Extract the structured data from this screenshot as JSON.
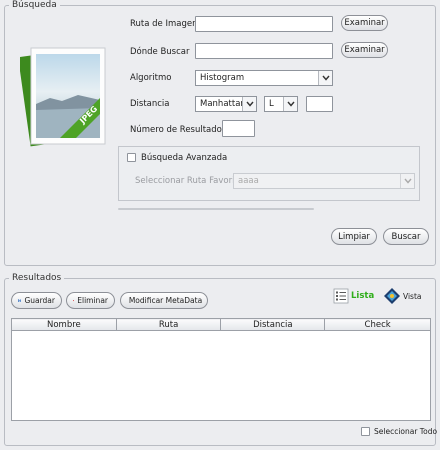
{
  "search": {
    "legend": "Búsqueda",
    "image_path": {
      "label": "Ruta de Imagen",
      "value": ""
    },
    "search_where": {
      "label": "Dónde Buscar",
      "value": ""
    },
    "browse_label": "Examinar",
    "algorithm": {
      "label": "Algoritmo",
      "selected": "Histogram"
    },
    "distance": {
      "label": "Distancia",
      "metric": "Manhattan",
      "norm": "L",
      "value": ""
    },
    "result_count": {
      "label": "Número de Resultados",
      "value": ""
    },
    "thumbnail_badge": "JPEG",
    "advanced": {
      "label": "Búsqueda Avanzada",
      "checked": false,
      "favorite_route_label": "Seleccionar Ruta Favorita",
      "favorite_route_value": "aaaa"
    },
    "clear_label": "Limpiar",
    "search_label": "Buscar"
  },
  "results": {
    "legend": "Resultados",
    "save_label": "Guardar",
    "delete_label": "Eliminar",
    "modify_metadata_label": "Modificar MetaData",
    "list_view_label": "Lista",
    "grid_view_label": "Vista",
    "columns": [
      "Nombre",
      "Ruta",
      "Distancia",
      "Check"
    ],
    "rows": [],
    "select_all_label": "Seleccionar Todo"
  },
  "colors": {
    "list_view_active": "#2fae1a",
    "delete_icon": "#d0161a",
    "save_icon": "#2e6bbd"
  }
}
